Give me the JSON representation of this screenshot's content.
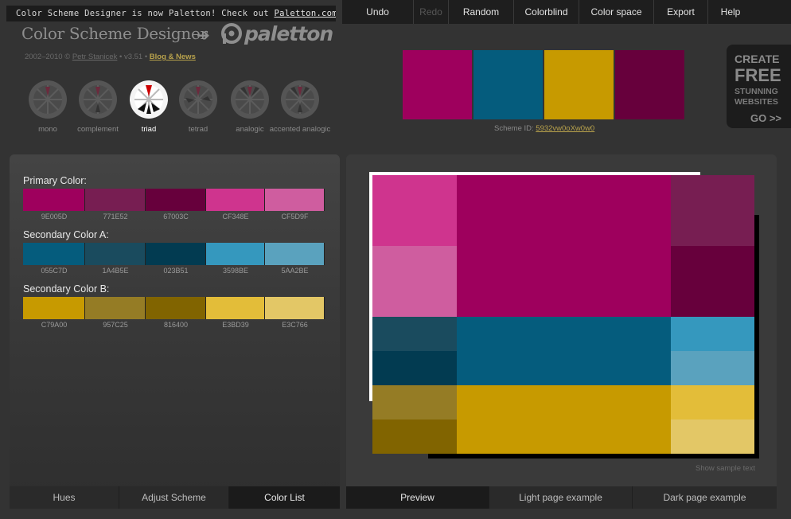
{
  "banner": {
    "text": "Color Scheme Designer is now Paletton! Check out ",
    "link": "Paletton.com"
  },
  "menu": [
    "Undo",
    "Redo",
    "Random",
    "Colorblind",
    "Color space",
    "Export",
    "Help"
  ],
  "logo": {
    "title": "Color Scheme Designer",
    "arrow": "➔",
    "brand": "paletton"
  },
  "byline": {
    "years": "2002–2010 © ",
    "author": "Petr Stanicek",
    "version": " • v3.51 • ",
    "blog": "Blog & News"
  },
  "schemes": [
    {
      "label": "mono",
      "active": false
    },
    {
      "label": "complement",
      "active": false
    },
    {
      "label": "triad",
      "active": true
    },
    {
      "label": "tetrad",
      "active": false
    },
    {
      "label": "analogic",
      "active": false
    },
    {
      "label": "accented analogic",
      "active": false
    }
  ],
  "scheme_swatches": [
    "#9E005D",
    "#055C7D",
    "#C79A00",
    "#67003C"
  ],
  "scheme_id": {
    "label": "Scheme ID: ",
    "value": "5932vw0oXw0w0"
  },
  "ad": {
    "line1": "CREATE",
    "line2": "FREE",
    "line3": "STUNNING",
    "line4": "WEBSITES",
    "cta": "GO >>"
  },
  "color_groups": [
    {
      "title": "Primary Color:",
      "colors": [
        "9E005D",
        "771E52",
        "67003C",
        "CF348E",
        "CF5D9F"
      ]
    },
    {
      "title": "Secondary Color A:",
      "colors": [
        "055C7D",
        "1A4B5E",
        "023B51",
        "3598BE",
        "5AA2BE"
      ]
    },
    {
      "title": "Secondary Color B:",
      "colors": [
        "C79A00",
        "957C25",
        "816400",
        "E3BD39",
        "E3C766"
      ]
    }
  ],
  "left_tabs": [
    {
      "label": "Hues",
      "active": false
    },
    {
      "label": "Adjust Scheme",
      "active": false
    },
    {
      "label": "Color List",
      "active": true
    }
  ],
  "right_tabs": [
    {
      "label": "Preview",
      "active": true
    },
    {
      "label": "Light page example",
      "active": false
    },
    {
      "label": "Dark page example",
      "active": false
    }
  ],
  "sample_link": "Show sample text",
  "colors": {
    "page_bg": "#333333",
    "link_gold": "#B8A24C"
  }
}
